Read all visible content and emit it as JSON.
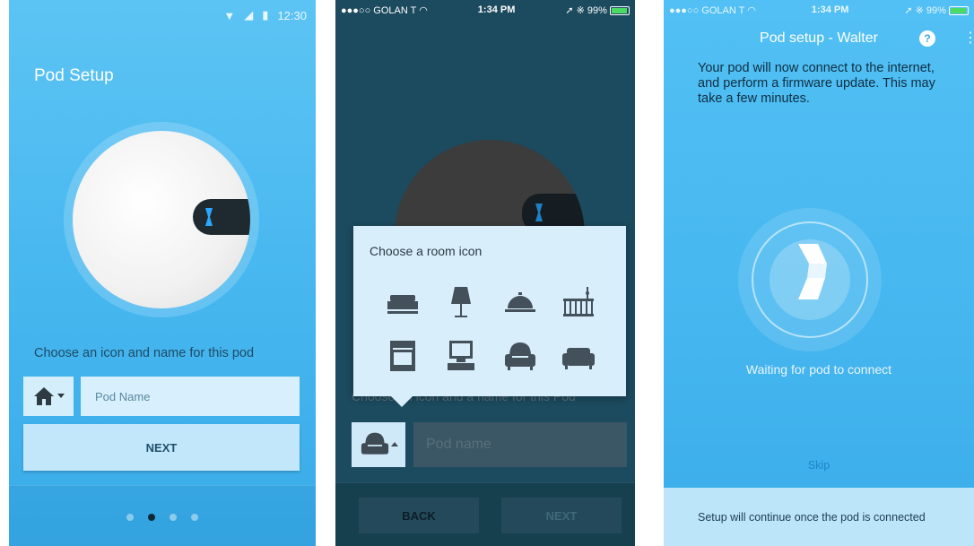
{
  "screen_android": {
    "status_time": "12:30",
    "title": "Pod Setup",
    "caption": "Choose an icon and name for this pod",
    "name_placeholder": "Pod Name",
    "next_label": "NEXT",
    "page_index": 2,
    "page_count": 4
  },
  "screen_ios_modal": {
    "carrier": "●●●○○ GOLAN T ◠",
    "time": "1:34 PM",
    "battery": "99%",
    "modal_title": "Choose a room icon",
    "room_icons": [
      "bed-icon",
      "lamp-icon",
      "dish-icon",
      "crib-icon",
      "oven-icon",
      "computer-icon",
      "armchair-icon",
      "sofa-icon"
    ],
    "background_caption": "Choose an icon and a name for this Pod",
    "name_placeholder": "Pod name",
    "back_label": "BACK",
    "next_label": "NEXT"
  },
  "screen_ios_waiting": {
    "carrier": "●●●○○ GOLAN T ◠",
    "time": "1:34 PM",
    "battery": "99%",
    "title": "Pod setup - Walter",
    "help_glyph": "?",
    "description": "Your pod will now connect to the internet, and perform a firmware update. This may take a few minutes.",
    "waiting_text": "Waiting for pod to connect",
    "skip_label": "Skip",
    "footer_text": "Setup will continue once the pod is connected"
  },
  "colors": {
    "android_bg": "#46b6ef",
    "ios_dark_bg": "#1c4a5e",
    "pod_led": "#2aa7ff",
    "page_dot_active": "#0e2838"
  }
}
